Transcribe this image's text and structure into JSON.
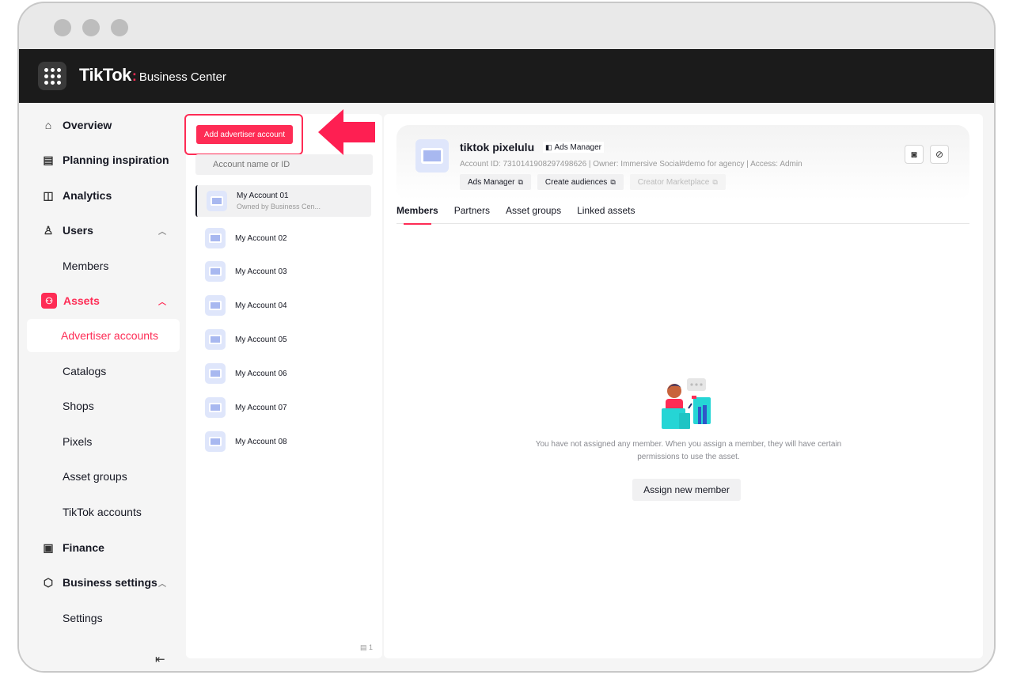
{
  "app": {
    "brand_tiktok": "TikTok",
    "brand_colon": ":",
    "brand_product": "Business Center",
    "accent_color": "#fe2c55"
  },
  "sidebar": {
    "items": [
      {
        "label": "Overview",
        "icon": "home-icon"
      },
      {
        "label": "Planning inspiration",
        "icon": "planning-icon"
      },
      {
        "label": "Analytics",
        "icon": "analytics-icon"
      },
      {
        "label": "Users",
        "icon": "users-icon"
      },
      {
        "label": "Members"
      },
      {
        "label": "Assets",
        "icon": "assets-icon"
      },
      {
        "label": "Advertiser accounts"
      },
      {
        "label": "Catalogs"
      },
      {
        "label": "Shops"
      },
      {
        "label": "Pixels"
      },
      {
        "label": "Asset groups"
      },
      {
        "label": "TikTok accounts"
      },
      {
        "label": "Finance",
        "icon": "finance-icon"
      },
      {
        "label": "Business settings",
        "icon": "settings-icon"
      },
      {
        "label": "Settings"
      }
    ]
  },
  "list": {
    "add_label": "Add advertiser account",
    "search_placeholder": "Account name or ID",
    "accounts": [
      {
        "name": "My Account 01",
        "sub": "Owned by Business Cen..."
      },
      {
        "name": "My Account 02"
      },
      {
        "name": "My Account 03"
      },
      {
        "name": "My Account 04"
      },
      {
        "name": "My Account 05"
      },
      {
        "name": "My Account 06"
      },
      {
        "name": "My Account 07"
      },
      {
        "name": "My Account 08"
      }
    ],
    "page_count": "1"
  },
  "detail": {
    "title": "tiktok pixelulu",
    "badge": "Ads Manager",
    "meta": "Account ID: 7310141908297498626 | Owner: Immersive Social#demo for agency | Access: Admin",
    "links": [
      {
        "label": "Ads Manager",
        "enabled": true
      },
      {
        "label": "Create audiences",
        "enabled": true
      },
      {
        "label": "Creator Marketplace",
        "enabled": false
      }
    ],
    "tabs": [
      "Members",
      "Partners",
      "Asset groups",
      "Linked assets"
    ],
    "empty_message": "You have not assigned any member. When you assign a member, they will have certain permissions to use the asset.",
    "assign_label": "Assign new member"
  }
}
